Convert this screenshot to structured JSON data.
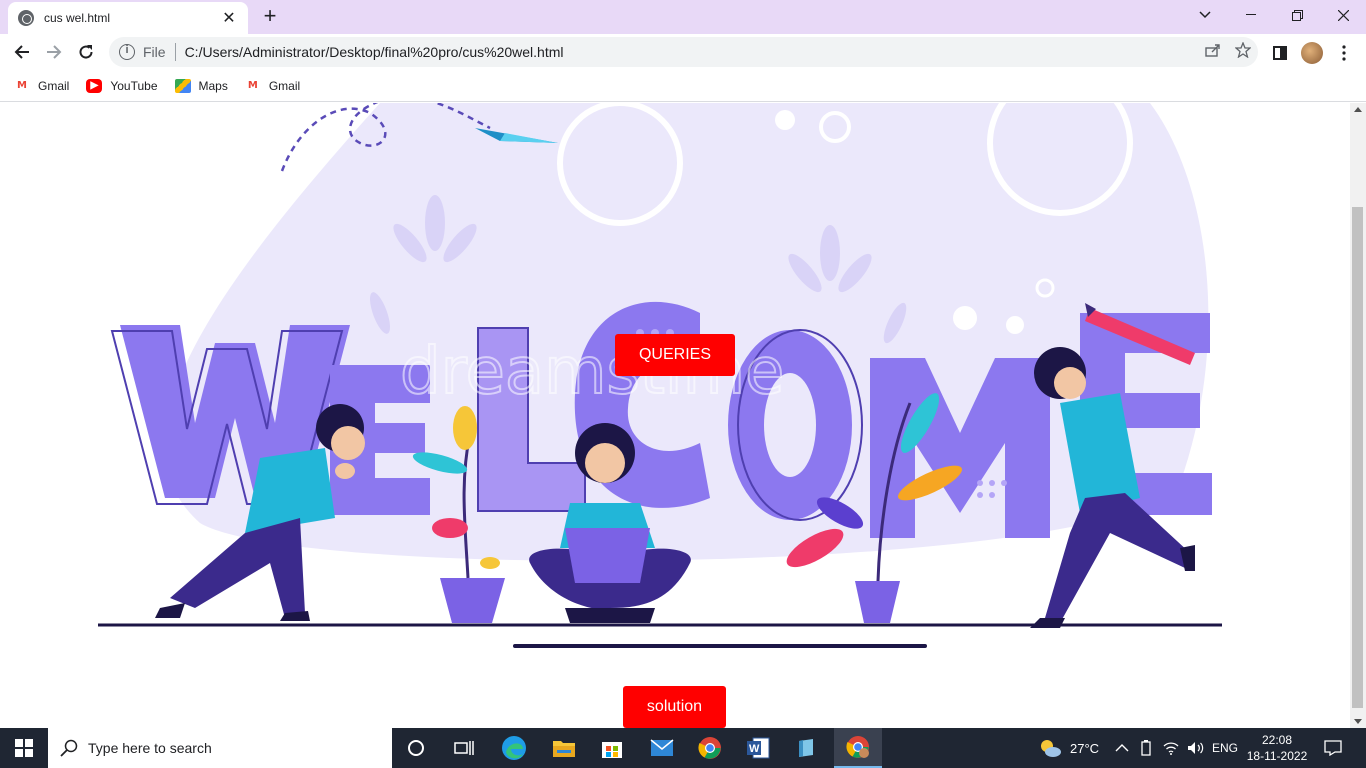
{
  "browser": {
    "tab_title": "cus wel.html",
    "tab_close": "✕",
    "new_tab": "+",
    "file_label": "File",
    "url": "C:/Users/Administrator/Desktop/final%20pro/cus%20wel.html",
    "bookmarks": [
      {
        "label": "Gmail",
        "icon": "gmail-icon"
      },
      {
        "label": "YouTube",
        "icon": "youtube-icon"
      },
      {
        "label": "Maps",
        "icon": "maps-icon"
      },
      {
        "label": "Gmail",
        "icon": "gmail-icon"
      }
    ]
  },
  "page": {
    "hero_image": "welcome-illustration",
    "hero_watermark": "dreamstime",
    "queries_button": "QUERIES",
    "solution_button": "solution",
    "button_color": "#ff0000"
  },
  "taskbar": {
    "search_placeholder": "Type here to search",
    "weather": "27°C",
    "language": "ENG",
    "time": "22:08",
    "date": "18-11-2022"
  }
}
